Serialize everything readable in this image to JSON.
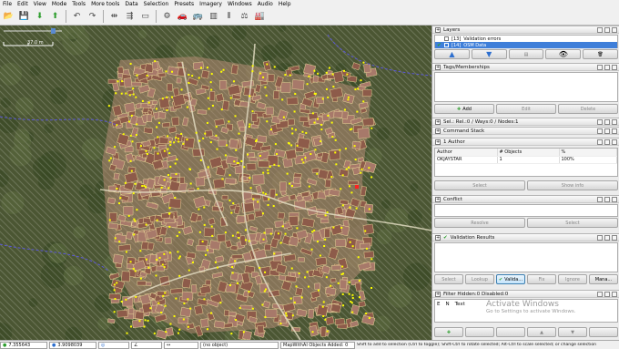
{
  "menu": [
    "File",
    "Edit",
    "View",
    "Mode",
    "Tools",
    "More tools",
    "Data",
    "Selection",
    "Presets",
    "Imagery",
    "Windows",
    "Audio",
    "Help"
  ],
  "toolbar_icons": [
    "open-icon",
    "save-icon",
    "download-icon",
    "upload-icon",
    "undo-icon",
    "redo-icon",
    "split-icon",
    "combine-icon",
    "wireframe-icon",
    "preferences-icon",
    "presets-car-icon",
    "presets-bus-icon",
    "presets-gate-icon",
    "presets-wall-icon",
    "presets-scale-icon",
    "presets-industrial-icon"
  ],
  "map": {
    "scale_label": "37.0 m",
    "colors": {
      "background": "#4b5633",
      "buildings": "#a7796a",
      "nodes": "#ffff00",
      "selection": "#ffff3c",
      "marker": "#ff2222"
    }
  },
  "layers": {
    "title": "Layers",
    "items": [
      {
        "index": "[13]",
        "name": "Validation errors",
        "selected": false
      },
      {
        "index": "[14]",
        "name": "OSM Data",
        "selected": true
      }
    ]
  },
  "tags": {
    "title": "Tags/Memberships",
    "buttons": [
      "Add",
      "Edit",
      "Delete"
    ]
  },
  "selection": {
    "title": "Sel.: Rel.:0 / Ways:0 / Nodes:1"
  },
  "command_stack": {
    "title": "Command Stack"
  },
  "authors": {
    "title": "1 Author",
    "columns": [
      "Author",
      "# Objects",
      "%"
    ],
    "rows": [
      [
        "OKJAYSTAR",
        "1",
        "100%"
      ]
    ],
    "buttons": [
      "Select",
      "Show info"
    ]
  },
  "conflict": {
    "title": "Conflict",
    "buttons": [
      "Resolve",
      "Select"
    ]
  },
  "validation": {
    "title": "Validation Results",
    "buttons": [
      "Select",
      "Lookup",
      "Valida...",
      "Fix",
      "Ignore",
      "Mana..."
    ]
  },
  "filter": {
    "title": "Filter Hidden:0 Disabled:0",
    "row_e": "E",
    "row_n": "N",
    "row_text": "Text"
  },
  "activation": {
    "line1": "Activate Windows",
    "line2": "Go to Settings to activate Windows."
  },
  "status": {
    "lat": "7.355643",
    "lon": "3.9098039",
    "heading": "",
    "angle": "",
    "length": "",
    "object": "(no object)",
    "layer_info": "MapWithAI Objects Added: 0",
    "hint": "Shift to add to selection (Ctrl to toggle); Shift-Ctrl to rotate selected; Alt-Ctrl to scale selected; or change selection"
  }
}
